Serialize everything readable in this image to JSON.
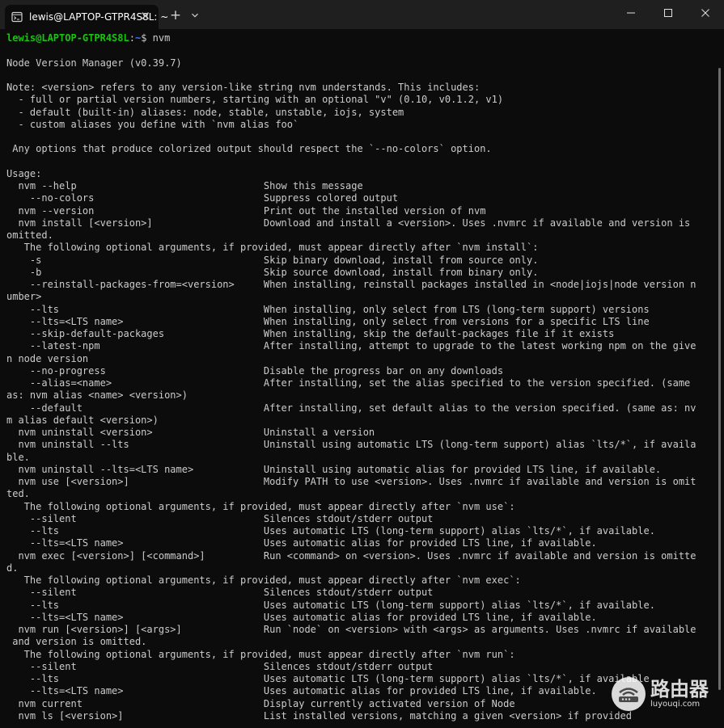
{
  "window": {
    "tab_title": "lewis@LAPTOP-GTPR4S8L: ~",
    "tab_close": "✕",
    "new_tab": "+"
  },
  "prompt": {
    "user": "lewis@LAPTOP-GTPR4S8L",
    "sep": ":",
    "path": "~",
    "symbol": "$ ",
    "command": "nvm"
  },
  "output": [
    "",
    "Node Version Manager (v0.39.7)",
    "",
    "Note: <version> refers to any version-like string nvm understands. This includes:",
    "  - full or partial version numbers, starting with an optional \"v\" (0.10, v0.1.2, v1)",
    "  - default (built-in) aliases: node, stable, unstable, iojs, system",
    "  - custom aliases you define with `nvm alias foo`",
    "",
    " Any options that produce colorized output should respect the `--no-colors` option.",
    "",
    "Usage:",
    "  nvm --help                                Show this message",
    "    --no-colors                             Suppress colored output",
    "  nvm --version                             Print out the installed version of nvm",
    "  nvm install [<version>]                   Download and install a <version>. Uses .nvmrc if available and version is",
    "omitted.",
    "   The following optional arguments, if provided, must appear directly after `nvm install`:",
    "    -s                                      Skip binary download, install from source only.",
    "    -b                                      Skip source download, install from binary only.",
    "    --reinstall-packages-from=<version>     When installing, reinstall packages installed in <node|iojs|node version n",
    "umber>",
    "    --lts                                   When installing, only select from LTS (long-term support) versions",
    "    --lts=<LTS name>                        When installing, only select from versions for a specific LTS line",
    "    --skip-default-packages                 When installing, skip the default-packages file if it exists",
    "    --latest-npm                            After installing, attempt to upgrade to the latest working npm on the give",
    "n node version",
    "    --no-progress                           Disable the progress bar on any downloads",
    "    --alias=<name>                          After installing, set the alias specified to the version specified. (same",
    "as: nvm alias <name> <version>)",
    "    --default                               After installing, set default alias to the version specified. (same as: nv",
    "m alias default <version>)",
    "  nvm uninstall <version>                   Uninstall a version",
    "  nvm uninstall --lts                       Uninstall using automatic LTS (long-term support) alias `lts/*`, if availa",
    "ble.",
    "  nvm uninstall --lts=<LTS name>            Uninstall using automatic alias for provided LTS line, if available.",
    "  nvm use [<version>]                       Modify PATH to use <version>. Uses .nvmrc if available and version is omit",
    "ted.",
    "   The following optional arguments, if provided, must appear directly after `nvm use`:",
    "    --silent                                Silences stdout/stderr output",
    "    --lts                                   Uses automatic LTS (long-term support) alias `lts/*`, if available.",
    "    --lts=<LTS name>                        Uses automatic alias for provided LTS line, if available.",
    "  nvm exec [<version>] [<command>]          Run <command> on <version>. Uses .nvmrc if available and version is omitte",
    "d.",
    "   The following optional arguments, if provided, must appear directly after `nvm exec`:",
    "    --silent                                Silences stdout/stderr output",
    "    --lts                                   Uses automatic LTS (long-term support) alias `lts/*`, if available.",
    "    --lts=<LTS name>                        Uses automatic alias for provided LTS line, if available.",
    "  nvm run [<version>] [<args>]              Run `node` on <version> with <args> as arguments. Uses .nvmrc if available",
    " and version is omitted.",
    "   The following optional arguments, if provided, must appear directly after `nvm run`:",
    "    --silent                                Silences stdout/stderr output",
    "    --lts                                   Uses automatic LTS (long-term support) alias `lts/*`, if available.",
    "    --lts=<LTS name>                        Uses automatic alias for provided LTS line, if available.",
    "  nvm current                               Display currently activated version of Node",
    "  nvm ls [<version>]                        List installed versions, matching a given <version> if provided"
  ],
  "watermark": {
    "cn": "路由器",
    "en": "luyouqi.com"
  },
  "colors": {
    "background": "#0c0c0c",
    "titlebar": "#1f1f1f",
    "text": "#cccccc",
    "prompt_user": "#16c60c",
    "prompt_path": "#3b78ff"
  }
}
